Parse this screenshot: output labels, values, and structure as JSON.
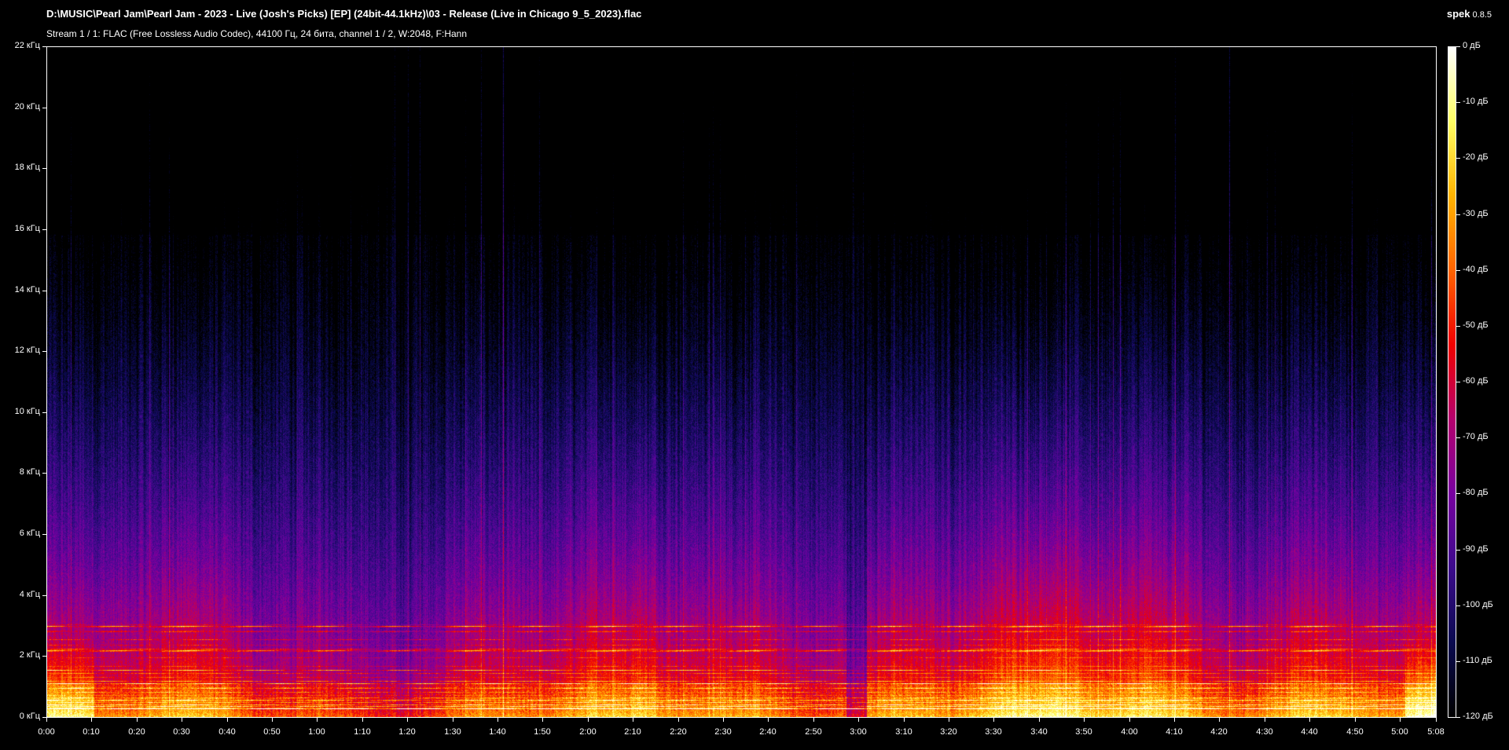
{
  "header": {
    "title": "D:\\MUSIC\\Pearl Jam\\Pearl Jam - 2023 - Live (Josh's Picks) [EP] (24bit-44.1kHz)\\03 - Release (Live in Chicago 9_5_2023).flac",
    "stream_info": "Stream 1 / 1: FLAC (Free Lossless Audio Codec), 44100 Гц, 24 бита, channel 1 / 2, W:2048, F:Hann",
    "app_name": "spek",
    "app_version": "0.8.5"
  },
  "spectrogram": {
    "freq_axis": {
      "min_khz": 0,
      "max_khz": 22,
      "labels": [
        "0 кГц",
        "2 кГц",
        "4 кГц",
        "6 кГц",
        "8 кГц",
        "10 кГц",
        "12 кГц",
        "14 кГц",
        "16 кГц",
        "18 кГц",
        "20 кГц",
        "22 кГц"
      ]
    },
    "time_axis": {
      "duration_seconds": 308,
      "labels": [
        "0:00",
        "0:10",
        "0:20",
        "0:30",
        "0:40",
        "0:50",
        "1:00",
        "1:10",
        "1:20",
        "1:30",
        "1:40",
        "1:50",
        "2:00",
        "2:10",
        "2:20",
        "2:30",
        "2:40",
        "2:50",
        "3:00",
        "3:10",
        "3:20",
        "3:30",
        "3:40",
        "3:50",
        "4:00",
        "4:10",
        "4:20",
        "4:30",
        "4:40",
        "4:50",
        "5:00",
        "5:08"
      ]
    },
    "db_scale": {
      "min_db": -120,
      "max_db": 0,
      "labels": [
        "0 дБ",
        "-10 дБ",
        "-20 дБ",
        "-30 дБ",
        "-40 дБ",
        "-50 дБ",
        "-60 дБ",
        "-70 дБ",
        "-80 дБ",
        "-90 дБ",
        "-100 дБ",
        "-110 дБ",
        "-120 дБ"
      ]
    },
    "palette": [
      "#000000",
      "#0a0a50",
      "#3c0a8c",
      "#7800a0",
      "#b4006e",
      "#f00000",
      "#ff6400",
      "#ffb400",
      "#ffff64",
      "#ffffff"
    ]
  }
}
